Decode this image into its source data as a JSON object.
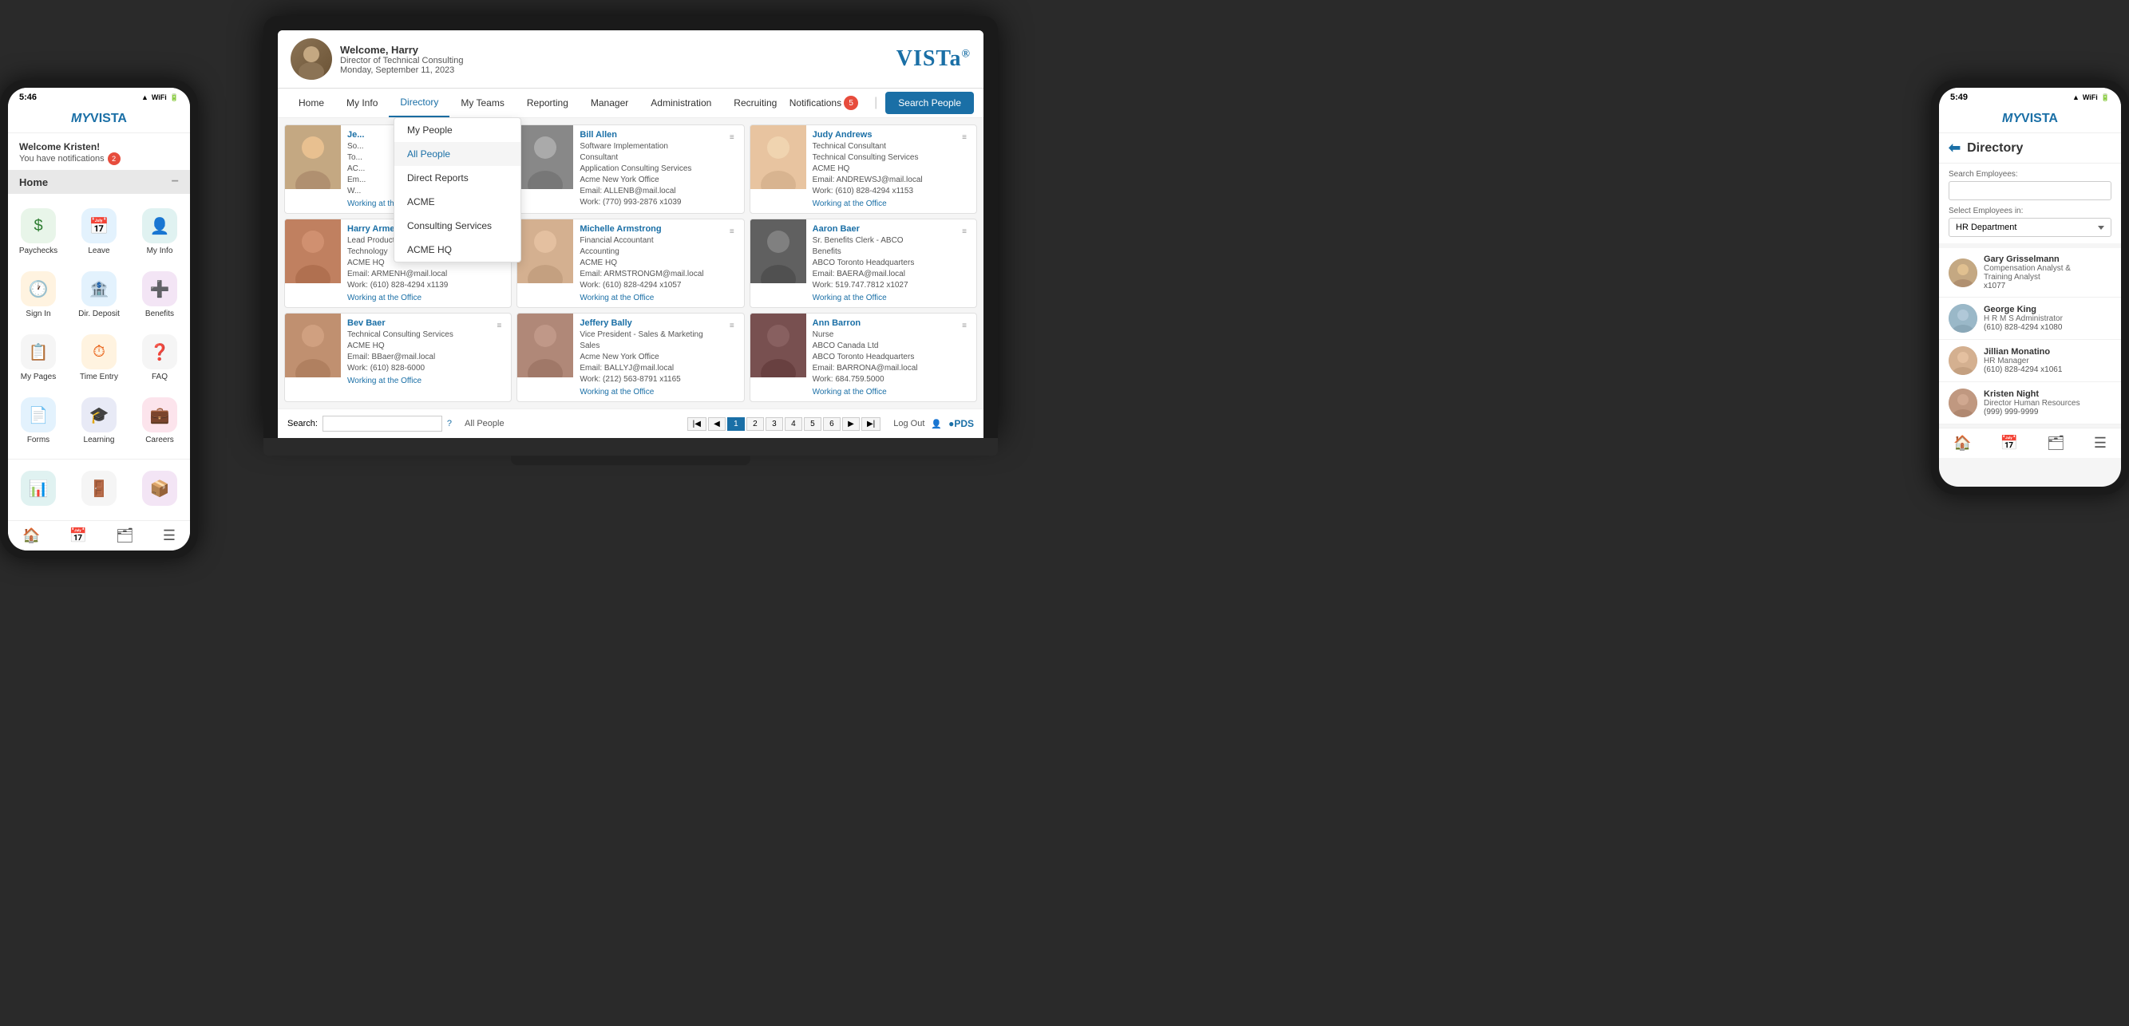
{
  "left_phone": {
    "time": "5:46",
    "signal": "●●●",
    "wifi": "WiFi",
    "battery": "🔋",
    "app_name": "MY VISTA",
    "welcome": "Welcome Kristen!",
    "notifications_text": "You have notifications",
    "notifications_count": "2",
    "section_home": "Home",
    "minimize": "−",
    "grid_items": [
      {
        "label": "Paychecks",
        "icon": "$",
        "icon_class": "icon-green"
      },
      {
        "label": "Leave",
        "icon": "📅",
        "icon_class": "icon-blue"
      },
      {
        "label": "My Info",
        "icon": "👤",
        "icon_class": "icon-teal"
      },
      {
        "label": "Sign In",
        "icon": "🕐",
        "icon_class": "icon-orange"
      },
      {
        "label": "Dir. Deposit",
        "icon": "🏦",
        "icon_class": "icon-blue"
      },
      {
        "label": "Benefits",
        "icon": "➕",
        "icon_class": "icon-purple"
      },
      {
        "label": "My Pages",
        "icon": "📋",
        "icon_class": "icon-gray"
      },
      {
        "label": "Time Entry",
        "icon": "⏱",
        "icon_class": "icon-orange"
      },
      {
        "label": "FAQ",
        "icon": "❓",
        "icon_class": "icon-gray"
      },
      {
        "label": "Forms",
        "icon": "📄",
        "icon_class": "icon-blue"
      },
      {
        "label": "Learning",
        "icon": "🎓",
        "icon_class": "icon-indigo"
      },
      {
        "label": "Careers",
        "icon": "💼",
        "icon_class": "icon-pink"
      }
    ],
    "bottom_nav": [
      "🏠",
      "📅",
      "🗂",
      "☰"
    ]
  },
  "laptop": {
    "user_name": "Welcome, Harry",
    "user_title": "Director of Technical Consulting",
    "user_date": "Monday, September 11, 2023",
    "logo": "VISTa",
    "nav_items": [
      "Home",
      "My Info",
      "Directory",
      "My Teams",
      "Reporting",
      "Manager",
      "Administration",
      "Recruiting"
    ],
    "notifications_label": "Notifications",
    "notifications_count": "5",
    "search_people_btn": "Search People",
    "dropdown": {
      "items": [
        {
          "label": "My People",
          "active": false
        },
        {
          "label": "All People",
          "active": true
        },
        {
          "label": "Direct Reports",
          "active": false
        },
        {
          "label": "ACME",
          "active": false
        },
        {
          "label": "Consulting Services",
          "active": false
        },
        {
          "label": "ACME HQ",
          "active": false
        }
      ]
    },
    "people": [
      {
        "name": "Je...",
        "title": "",
        "dept": "",
        "location": "",
        "email": "",
        "work": "",
        "status": "Working at the Office",
        "photo_class": "photo-1"
      },
      {
        "name": "Bill Allen",
        "title": "Software Implementation Consultant",
        "dept": "Application Consulting Services",
        "location": "Acme New York Office",
        "email": "Email: ALLENB@mail.local",
        "work": "Work: (770) 993-2876 x1039",
        "status": "",
        "photo_class": "photo-2"
      },
      {
        "name": "Judy Andrews",
        "title": "Technical Consultant",
        "dept": "Technical Consulting Services",
        "location": "ACME HQ",
        "email": "Email: ANDREWSJ@mail.local",
        "work": "Work: (610) 828-4294 x1153",
        "status": "Working at the Office",
        "photo_class": "photo-3"
      },
      {
        "name": "Harry Armen",
        "title": "Lead Product Release Specialist",
        "dept": "Technology",
        "location": "ACME HQ",
        "email": "Email: ARMENH@mail.local",
        "work": "Work: (610) 828-4294 x1139",
        "status": "Working at the Office",
        "photo_class": "photo-4"
      },
      {
        "name": "Michelle Armstrong",
        "title": "Financial Accountant",
        "dept": "Accounting",
        "location": "ACME HQ",
        "email": "Email: ARMSTRONGM@mail.local",
        "work": "Work: (610) 828-4294 x1057",
        "status": "Working at the Office",
        "photo_class": "photo-5"
      },
      {
        "name": "Aaron Baer",
        "title": "Sr. Benefits Clerk - ABCO",
        "dept": "Benefits",
        "location": "ABCO Toronto Headquarters",
        "email": "Email: BAERA@mail.local",
        "work": "Work: 519.747.7812 x1027",
        "status": "Working at the Office",
        "photo_class": "photo-6"
      },
      {
        "name": "Bev Baer",
        "title": "Technical Consulting Services",
        "dept": "",
        "location": "ACME HQ",
        "email": "Email: BBaer@mail.local",
        "work": "Work: (610) 828-6000",
        "status": "Working at the Office",
        "photo_class": "photo-7"
      },
      {
        "name": "Jeffery Bally",
        "title": "Vice President - Sales & Marketing",
        "dept": "Sales",
        "location": "Acme New York Office",
        "email": "Email: BALLYJ@mail.local",
        "work": "Work: (212) 563-8791 x1165",
        "status": "Working at the Office",
        "photo_class": "photo-8"
      },
      {
        "name": "Ann Barron",
        "title": "Nurse",
        "dept": "ABCO Canada Ltd",
        "location": "ABCO Toronto Headquarters",
        "email": "Email: BARRONA@mail.local",
        "work": "Work: 684.759.5000",
        "status": "Working at the Office",
        "photo_class": "photo-9"
      }
    ],
    "footer": {
      "search_label": "Search:",
      "filter_label": "All People",
      "pages": [
        "1",
        "2",
        "3",
        "4",
        "5",
        "6"
      ],
      "active_page": "1",
      "logout_label": "Log Out"
    }
  },
  "right_phone": {
    "time": "5:49",
    "signal": "●●●",
    "app_name": "MY VISTA",
    "back_icon": "←",
    "title": "Directory",
    "search_employees_label": "Search Employees:",
    "search_placeholder": "",
    "select_label": "Select Employees in:",
    "select_value": "HR Department",
    "people": [
      {
        "name": "Gary Grisselmann",
        "role": "Compensation Analyst & Training Analyst",
        "phone": "x1077",
        "avatar_class": "dir-avatar-1"
      },
      {
        "name": "George King",
        "role": "H R M S Administrator",
        "phone": "(610) 828-4294 x1080",
        "avatar_class": "dir-avatar-2"
      },
      {
        "name": "Jillian Monatino",
        "role": "HR Manager",
        "phone": "(610) 828-4294 x1061",
        "avatar_class": "dir-avatar-3"
      },
      {
        "name": "Kristen Night",
        "role": "Director Human Resources",
        "phone": "(999) 999-9999",
        "avatar_class": "dir-avatar-4"
      }
    ],
    "bottom_nav": [
      "🏠",
      "📅",
      "🗂",
      "☰"
    ]
  }
}
